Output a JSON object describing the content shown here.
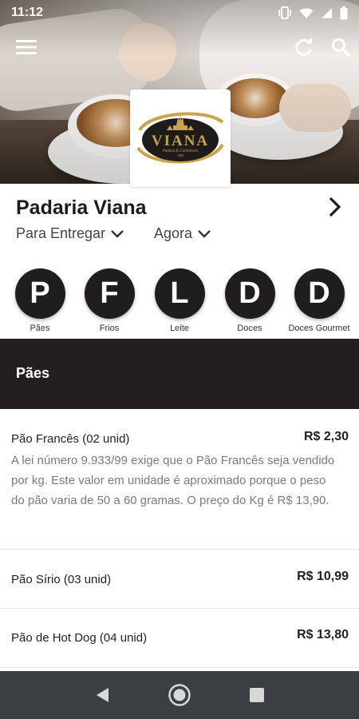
{
  "status_bar": {
    "time": "11:12"
  },
  "store": {
    "name": "Padaria Viana",
    "logo": {
      "brand": "VIANA",
      "tagline": "Padaria & Confeitaria",
      "since": "1968"
    },
    "delivery_mode": "Para Entregar",
    "schedule": "Agora"
  },
  "categories": [
    {
      "letter": "P",
      "label": "Pães"
    },
    {
      "letter": "F",
      "label": "Frios"
    },
    {
      "letter": "L",
      "label": "Leite"
    },
    {
      "letter": "D",
      "label": "Doces"
    },
    {
      "letter": "D",
      "label": "Doces Gourmet"
    }
  ],
  "section": {
    "title": "Pães"
  },
  "items": [
    {
      "name": "Pão Francês (02 unid)",
      "price": "R$ 2,30",
      "description": "A lei número 9.933/99 exige que o Pão Francês seja vendido por kg. Este valor em unidade é aproximado porque o peso do pão varia de 50 a 60 gramas. O preço do Kg é R$ 13,90."
    },
    {
      "name": "Pão Sírio (03 unid)",
      "price": "R$ 10,99"
    },
    {
      "name": "Pão de Hot Dog (04 unid)",
      "price": "R$ 13,80"
    }
  ],
  "colors": {
    "dark": "#231f20",
    "gold": "#c9a24a",
    "navbar": "#3a3f44"
  },
  "icons": [
    "menu-icon",
    "refresh-icon",
    "search-icon",
    "chevron-right-icon",
    "chevron-down-icon",
    "back-icon",
    "home-icon",
    "recents-icon"
  ]
}
